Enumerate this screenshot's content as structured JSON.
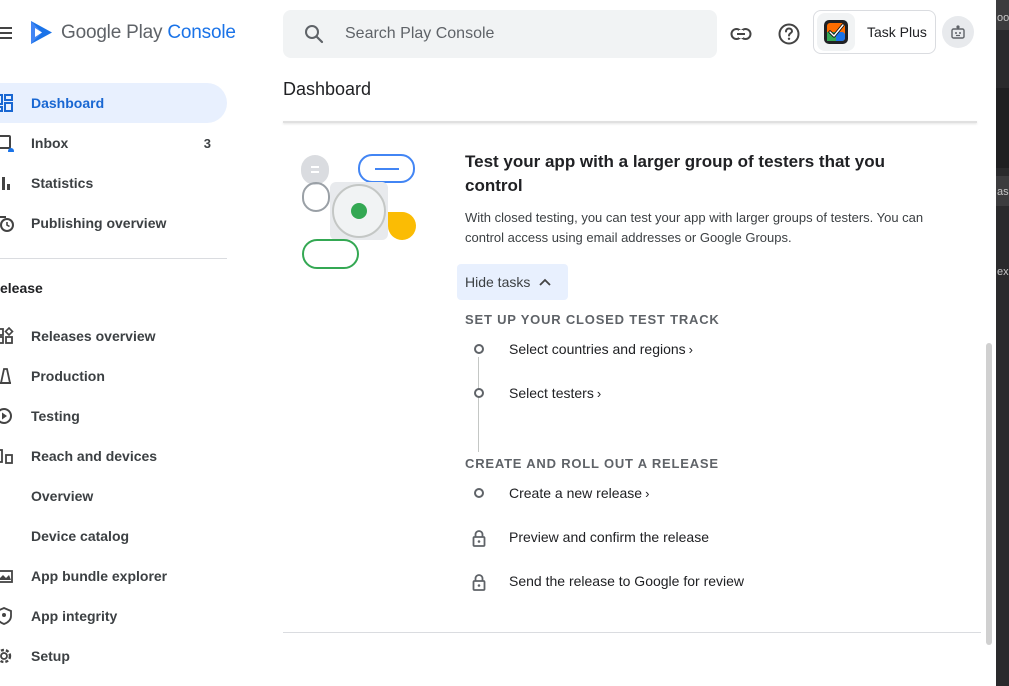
{
  "header": {
    "brand_prefix": "Google Play ",
    "brand_suffix": "Console",
    "search_placeholder": "Search Play Console",
    "app_name": "Task Plus"
  },
  "sidebar": {
    "items": [
      {
        "label": "Dashboard",
        "icon": "dashboard-icon",
        "active": true
      },
      {
        "label": "Inbox",
        "icon": "inbox-icon",
        "count": "3"
      },
      {
        "label": "Statistics",
        "icon": "statistics-icon"
      },
      {
        "label": "Publishing overview",
        "icon": "publishing-overview-icon"
      }
    ],
    "section_label": "elease",
    "release_items": [
      {
        "label": "Releases overview",
        "icon": "releases-overview-icon"
      },
      {
        "label": "Production",
        "icon": "production-icon"
      },
      {
        "label": "Testing",
        "icon": "testing-icon"
      },
      {
        "label": "Reach and devices",
        "icon": "reach-devices-icon"
      },
      {
        "label": "Overview"
      },
      {
        "label": "Device catalog"
      },
      {
        "label": "App bundle explorer",
        "icon": "app-bundle-icon"
      },
      {
        "label": "App integrity",
        "icon": "app-integrity-icon"
      },
      {
        "label": "Setup",
        "icon": "setup-gear-icon"
      }
    ]
  },
  "main": {
    "page_title": "Dashboard",
    "card": {
      "title": "Test your app with a larger group of testers that you control",
      "description": "With closed testing, you can test your app with larger groups of testers. You can control access using email addresses or Google Groups.",
      "hide_tasks_label": "Hide tasks",
      "groups": [
        {
          "title": "SET UP YOUR CLOSED TEST TRACK",
          "tasks": [
            {
              "label": "Select countries and regions",
              "chevron": "›",
              "locked": false
            },
            {
              "label": "Select testers",
              "chevron": "›",
              "locked": false
            }
          ]
        },
        {
          "title": "CREATE AND ROLL OUT A RELEASE",
          "tasks": [
            {
              "label": "Create a new release",
              "chevron": "›",
              "locked": false
            },
            {
              "label": "Preview and confirm the release",
              "locked": true
            },
            {
              "label": "Send the release to Google for review",
              "locked": true
            }
          ]
        }
      ]
    }
  },
  "behind_window": {
    "fragments": [
      "oo",
      "as",
      "ex"
    ]
  },
  "colors": {
    "accent": "#1a73e8",
    "active_bg": "#e8f0fe",
    "illustration_green": "#34a853",
    "illustration_yellow": "#fbbc04",
    "illustration_blue": "#4285f4"
  }
}
